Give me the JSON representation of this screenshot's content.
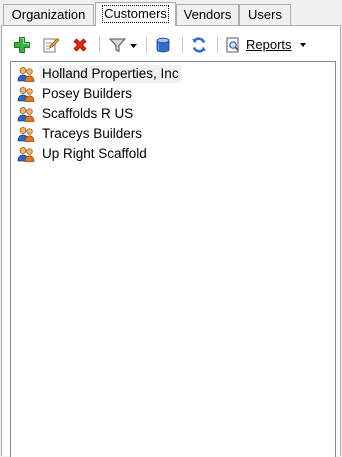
{
  "tabs": [
    {
      "label": "Organization",
      "active": false
    },
    {
      "label": "Customers",
      "active": true
    },
    {
      "label": "Vendors",
      "active": false
    },
    {
      "label": "Users",
      "active": false
    }
  ],
  "toolbar": {
    "add_icon": "add-icon",
    "edit_icon": "edit-icon",
    "delete_icon": "delete-icon",
    "filter_icon": "filter-icon",
    "database_icon": "database-icon",
    "refresh_icon": "refresh-icon",
    "reports_icon": "report-icon",
    "reports_label": "Reports"
  },
  "customers": {
    "items": [
      {
        "name": "Holland Properties, Inc",
        "selected": true
      },
      {
        "name": "Posey Builders",
        "selected": false
      },
      {
        "name": "Scaffolds R US",
        "selected": false
      },
      {
        "name": "Traceys Builders",
        "selected": false
      },
      {
        "name": "Up Right Scaffold",
        "selected": false
      }
    ],
    "item_icon": "customer-group-icon"
  },
  "colors": {
    "window_bg": "#f0f0f0",
    "panel_bg": "#ffffff",
    "add_green": "#2fa52f",
    "delete_red": "#d9261c",
    "db_blue": "#2b6fc7"
  }
}
